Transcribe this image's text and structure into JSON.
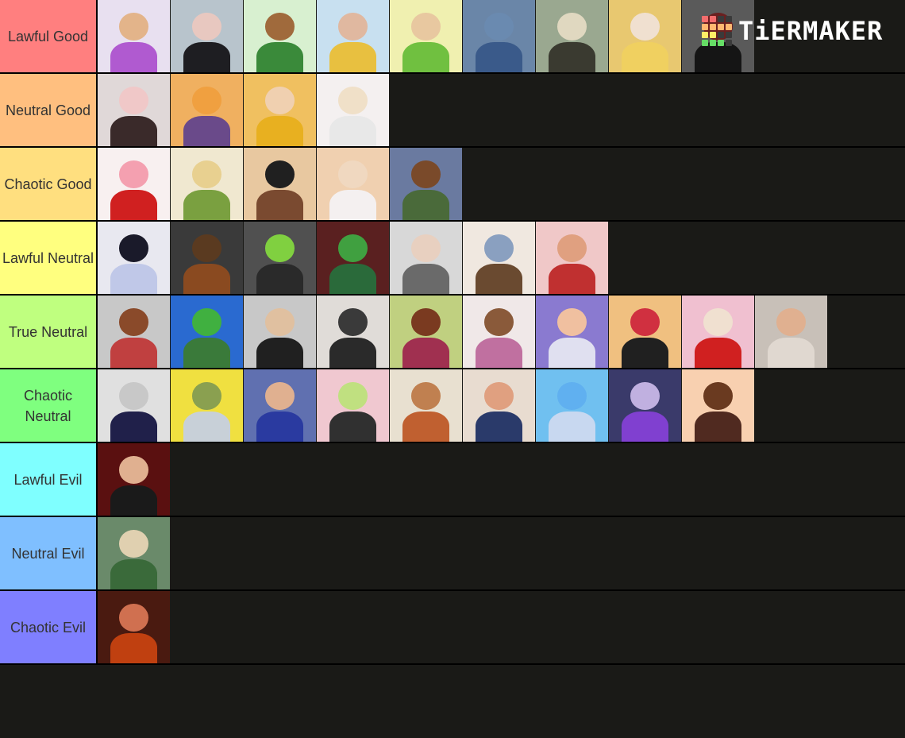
{
  "logo": {
    "text": "TiERMAKER",
    "grid_colors": [
      "#f26d6d",
      "#f26d6d",
      "#3a3a3a",
      "#3a3a3a",
      "#ffb870",
      "#ffb870",
      "#ffb870",
      "#ffb870",
      "#ffee66",
      "#ffee66",
      "#3a3a3a",
      "#3a3a3a",
      "#66dd66",
      "#66dd66",
      "#66dd66",
      "#3a3a3a"
    ]
  },
  "tiers": [
    {
      "label": "Lawful Good",
      "color": "#ff7f7f",
      "items": [
        [
          "#e8e0f0",
          "#b05ad0",
          "#e3b48a"
        ],
        [
          "#b8c4cc",
          "#1e1e22",
          "#e8c8c0"
        ],
        [
          "#d8f0d0",
          "#3a8a3a",
          "#a06a3c"
        ],
        [
          "#c8e0f0",
          "#e8c040",
          "#e0b8a0"
        ],
        [
          "#f0f0b0",
          "#70c040",
          "#e8c8a0"
        ],
        [
          "#6a86a8",
          "#3a5a8a",
          "#6a8ab0"
        ],
        [
          "#9aa890",
          "#3a3a30",
          "#e0d8c0"
        ],
        [
          "#e8c870",
          "#f0d060",
          "#f0e0d0"
        ],
        [
          "#5a5a5a",
          "#151515",
          "#6a2020"
        ]
      ]
    },
    {
      "label": "Neutral Good",
      "color": "#ffbf7f",
      "items": [
        [
          "#e0d8d8",
          "#3a2a2a",
          "#f0c8c8"
        ],
        [
          "#f0b060",
          "#6a4a8a",
          "#f0a040"
        ],
        [
          "#f0c060",
          "#e8b020",
          "#f0d0b0"
        ],
        [
          "#f4f0f0",
          "#e8e8e8",
          "#f0e0c8"
        ]
      ]
    },
    {
      "label": "Chaotic Good",
      "color": "#ffdf7f",
      "items": [
        [
          "#f8f0f0",
          "#d02020",
          "#f4a0b0"
        ],
        [
          "#f0e8d0",
          "#7aa040",
          "#e8d090"
        ],
        [
          "#e8c8a0",
          "#7a4a30",
          "#202020"
        ],
        [
          "#f0d0b0",
          "#f4f0f0",
          "#f0d8c0"
        ],
        [
          "#6a7aa0",
          "#4a6a3a",
          "#7a4a2a"
        ]
      ]
    },
    {
      "label": "Lawful Neutral",
      "color": "#ffff7f",
      "items": [
        [
          "#e8e8f0",
          "#c0c8e8",
          "#1a1a2a"
        ],
        [
          "#3a3a3a",
          "#8a4a20",
          "#5a3a20"
        ],
        [
          "#505050",
          "#2a2a2a",
          "#80d040"
        ],
        [
          "#5a2020",
          "#2a6a3a",
          "#40a040"
        ],
        [
          "#d8d8d8",
          "#6a6a6a",
          "#e8d0c0"
        ],
        [
          "#f0e8e0",
          "#6a4a30",
          "#8aa0c0"
        ],
        [
          "#f0c8c8",
          "#c03030",
          "#e0a080"
        ]
      ]
    },
    {
      "label": "True Neutral",
      "color": "#bfff7f",
      "items": [
        [
          "#c8c8c8",
          "#c04040",
          "#8a4a2a"
        ],
        [
          "#2a6ad0",
          "#3a7a3a",
          "#40b040"
        ],
        [
          "#c8c8c8",
          "#202020",
          "#e0c0a0"
        ],
        [
          "#e0dcd8",
          "#2a2a2a",
          "#3a3a3a"
        ],
        [
          "#c0d080",
          "#a03050",
          "#7a3a20"
        ],
        [
          "#f0e8e8",
          "#c070a0",
          "#8a5a3a"
        ],
        [
          "#8a7ad0",
          "#e0e0f0",
          "#f0c0a0"
        ],
        [
          "#f0c080",
          "#202020",
          "#d03040"
        ],
        [
          "#f0c0d0",
          "#d02020",
          "#f0e0d0"
        ],
        [
          "#c8c0b8",
          "#e0d8d0",
          "#e0b090"
        ]
      ]
    },
    {
      "label": "Chaotic Neutral",
      "color": "#7fff7f",
      "items": [
        [
          "#e0e0e0",
          "#20204a",
          "#c8c8c8"
        ],
        [
          "#f0e040",
          "#c8d0d8",
          "#8aa050"
        ],
        [
          "#6070b0",
          "#2a3aa0",
          "#e0b090"
        ],
        [
          "#f0c8d0",
          "#303030",
          "#c0e080"
        ],
        [
          "#e8e0d0",
          "#c06030",
          "#c08050"
        ],
        [
          "#e8dcd0",
          "#2a3a6a",
          "#e0a080"
        ],
        [
          "#70c0f0",
          "#c8d8f0",
          "#60b0f0"
        ],
        [
          "#3a3a6a",
          "#8040d0",
          "#c0b0e0"
        ],
        [
          "#f8d0b0",
          "#502a20",
          "#6a3a20"
        ]
      ]
    },
    {
      "label": "Lawful Evil",
      "color": "#7fffff",
      "items": [
        [
          "#5a1010",
          "#1a1a1a",
          "#e0b090"
        ]
      ]
    },
    {
      "label": "Neutral Evil",
      "color": "#7fbfff",
      "items": [
        [
          "#6a8a6a",
          "#3a6a3a",
          "#e0d0b0"
        ]
      ]
    },
    {
      "label": "Chaotic Evil",
      "color": "#7f7fff",
      "items": [
        [
          "#4a1a10",
          "#c04010",
          "#d07050"
        ]
      ]
    }
  ]
}
